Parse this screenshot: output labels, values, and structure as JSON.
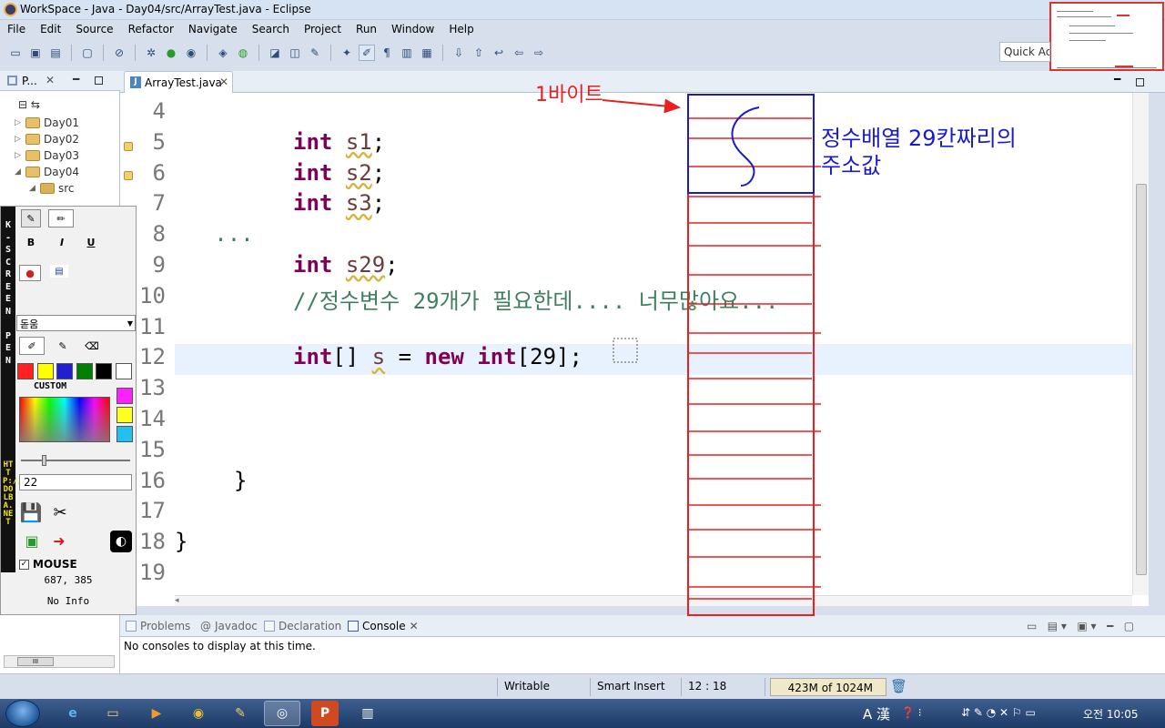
{
  "window": {
    "title": "WorkSpace - Java - Day04/src/ArrayTest.java - Eclipse"
  },
  "menu": [
    "File",
    "Edit",
    "Source",
    "Refactor",
    "Navigate",
    "Search",
    "Project",
    "Run",
    "Window",
    "Help"
  ],
  "toolbar": {
    "quick_access_placeholder": "Quick Access"
  },
  "package_explorer": {
    "tab_label": "P...",
    "items": [
      {
        "label": "Day01"
      },
      {
        "label": "Day02"
      },
      {
        "label": "Day03"
      },
      {
        "label": "Day04"
      },
      {
        "label": "src"
      }
    ]
  },
  "editor": {
    "tab_label": "ArrayTest.java",
    "lines": [
      {
        "num": "4",
        "code": ""
      },
      {
        "num": "5",
        "code": "int s1;"
      },
      {
        "num": "6",
        "code": "int s2;"
      },
      {
        "num": "7",
        "code": "int s3;"
      },
      {
        "num": "8",
        "code": "// ..."
      },
      {
        "num": "9",
        "code": "int s29;"
      },
      {
        "num": "10",
        "code": "//정수변수 29개가 필요한데.... 너무많아요..."
      },
      {
        "num": "11",
        "code": ""
      },
      {
        "num": "12",
        "code": "int[] s = new int[29];"
      },
      {
        "num": "13",
        "code": ""
      },
      {
        "num": "14",
        "code": ""
      },
      {
        "num": "15",
        "code": ""
      },
      {
        "num": "16",
        "code": "}"
      },
      {
        "num": "17",
        "code": ""
      },
      {
        "num": "18",
        "code": "}"
      },
      {
        "num": "19",
        "code": ""
      }
    ]
  },
  "screen_pen": {
    "vertical_title": [
      "K",
      "-",
      "S",
      "C",
      "R",
      "E",
      "E",
      "N",
      "",
      "P",
      "E",
      "N"
    ],
    "url": "HTTP://DOLBA.NET",
    "bold": "B",
    "italic": "I",
    "underline": "U",
    "font": "돋움",
    "custom_label": "CUSTOM",
    "size": "22",
    "mouse_label": "MOUSE",
    "coords": "687, 385",
    "info": "No Info",
    "colors": [
      "#ff2020",
      "#ffff00",
      "#2020d0",
      "#008000",
      "#000000",
      "#ffffff"
    ],
    "custom_colors": [
      "#ff20ff",
      "#ffff20",
      "#20c0f0"
    ]
  },
  "bottom_panel": {
    "tabs": [
      "Problems",
      "Javadoc",
      "Declaration",
      "Console"
    ],
    "active_tab": "Console",
    "message": "No consoles to display at this time."
  },
  "status": {
    "writable": "Writable",
    "insert_mode": "Smart Insert",
    "position": "12 : 18",
    "heap": "423M of 1024M"
  },
  "taskbar": {
    "time": "오전 10:05",
    "ime": "A 漢"
  },
  "annotations": {
    "one_byte": "1바이트",
    "array_address_line1": "정수배열 29칸짜리의",
    "array_address_line2": "주소값"
  },
  "colors": {
    "annotation_red": "#e82020",
    "annotation_blue": "#1a1ad0",
    "keyword": "#7f0055",
    "comment": "#3f7f5f"
  }
}
